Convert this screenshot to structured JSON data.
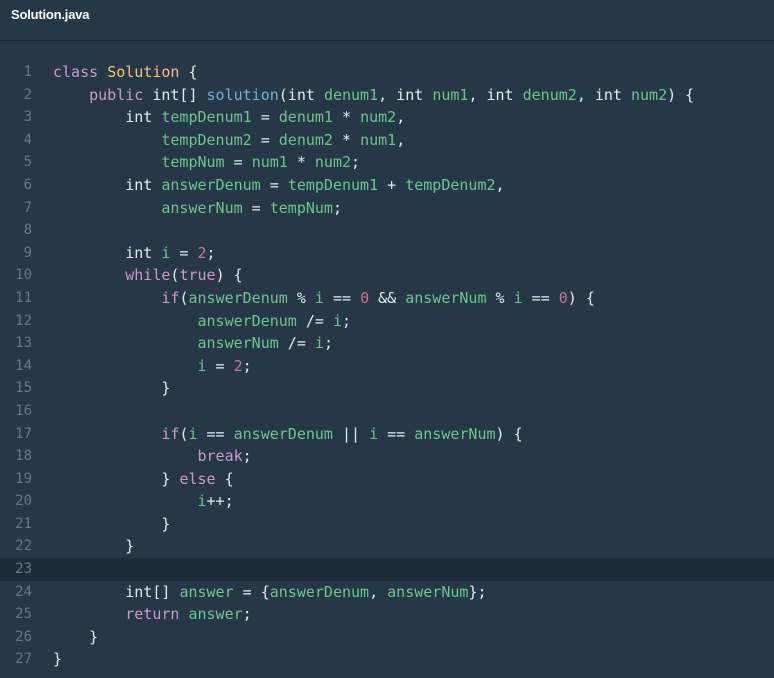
{
  "file": {
    "name": "Solution.java"
  },
  "colors": {
    "background": "#263747",
    "keyword": "#cc99cd",
    "class": "#f0c674",
    "function": "#6fb3d2",
    "variable": "#6cc78a",
    "number": "#d17297",
    "text": "#e6ebf0",
    "gutter": "#6b7787",
    "active_line": "#1e2b3a"
  },
  "editor": {
    "active_line": 23,
    "lines": [
      {
        "n": "1",
        "tokens": [
          [
            "keyword",
            "class"
          ],
          [
            "plain",
            " "
          ],
          [
            "class",
            "Solution"
          ],
          [
            "plain",
            " {"
          ]
        ]
      },
      {
        "n": "2",
        "tokens": [
          [
            "plain",
            "    "
          ],
          [
            "keyword",
            "public"
          ],
          [
            "plain",
            " int[] "
          ],
          [
            "fn",
            "solution"
          ],
          [
            "plain",
            "(int "
          ],
          [
            "var",
            "denum1"
          ],
          [
            "plain",
            ", int "
          ],
          [
            "var",
            "num1"
          ],
          [
            "plain",
            ", int "
          ],
          [
            "var",
            "denum2"
          ],
          [
            "plain",
            ", int "
          ],
          [
            "var",
            "num2"
          ],
          [
            "plain",
            ") {"
          ]
        ]
      },
      {
        "n": "3",
        "tokens": [
          [
            "plain",
            "        int "
          ],
          [
            "var",
            "tempDenum1"
          ],
          [
            "plain",
            " = "
          ],
          [
            "var",
            "denum1"
          ],
          [
            "plain",
            " * "
          ],
          [
            "var",
            "num2"
          ],
          [
            "plain",
            ","
          ]
        ]
      },
      {
        "n": "4",
        "tokens": [
          [
            "plain",
            "            "
          ],
          [
            "var",
            "tempDenum2"
          ],
          [
            "plain",
            " = "
          ],
          [
            "var",
            "denum2"
          ],
          [
            "plain",
            " * "
          ],
          [
            "var",
            "num1"
          ],
          [
            "plain",
            ","
          ]
        ]
      },
      {
        "n": "5",
        "tokens": [
          [
            "plain",
            "            "
          ],
          [
            "var",
            "tempNum"
          ],
          [
            "plain",
            " = "
          ],
          [
            "var",
            "num1"
          ],
          [
            "plain",
            " * "
          ],
          [
            "var",
            "num2"
          ],
          [
            "plain",
            ";"
          ]
        ]
      },
      {
        "n": "6",
        "tokens": [
          [
            "plain",
            "        int "
          ],
          [
            "var",
            "answerDenum"
          ],
          [
            "plain",
            " = "
          ],
          [
            "var",
            "tempDenum1"
          ],
          [
            "plain",
            " + "
          ],
          [
            "var",
            "tempDenum2"
          ],
          [
            "plain",
            ","
          ]
        ]
      },
      {
        "n": "7",
        "tokens": [
          [
            "plain",
            "            "
          ],
          [
            "var",
            "answerNum"
          ],
          [
            "plain",
            " = "
          ],
          [
            "var",
            "tempNum"
          ],
          [
            "plain",
            ";"
          ]
        ]
      },
      {
        "n": "8",
        "tokens": []
      },
      {
        "n": "9",
        "tokens": [
          [
            "plain",
            "        int "
          ],
          [
            "var",
            "i"
          ],
          [
            "plain",
            " = "
          ],
          [
            "num",
            "2"
          ],
          [
            "plain",
            ";"
          ]
        ]
      },
      {
        "n": "10",
        "tokens": [
          [
            "plain",
            "        "
          ],
          [
            "keyword",
            "while"
          ],
          [
            "plain",
            "("
          ],
          [
            "keyword",
            "true"
          ],
          [
            "plain",
            ") {"
          ]
        ]
      },
      {
        "n": "11",
        "tokens": [
          [
            "plain",
            "            "
          ],
          [
            "keyword",
            "if"
          ],
          [
            "plain",
            "("
          ],
          [
            "var",
            "answerDenum"
          ],
          [
            "plain",
            " % "
          ],
          [
            "var",
            "i"
          ],
          [
            "plain",
            " == "
          ],
          [
            "num",
            "0"
          ],
          [
            "plain",
            " && "
          ],
          [
            "var",
            "answerNum"
          ],
          [
            "plain",
            " % "
          ],
          [
            "var",
            "i"
          ],
          [
            "plain",
            " == "
          ],
          [
            "num",
            "0"
          ],
          [
            "plain",
            ") {"
          ]
        ]
      },
      {
        "n": "12",
        "tokens": [
          [
            "plain",
            "                "
          ],
          [
            "var",
            "answerDenum"
          ],
          [
            "plain",
            " /= "
          ],
          [
            "var",
            "i"
          ],
          [
            "plain",
            ";"
          ]
        ]
      },
      {
        "n": "13",
        "tokens": [
          [
            "plain",
            "                "
          ],
          [
            "var",
            "answerNum"
          ],
          [
            "plain",
            " /= "
          ],
          [
            "var",
            "i"
          ],
          [
            "plain",
            ";"
          ]
        ]
      },
      {
        "n": "14",
        "tokens": [
          [
            "plain",
            "                "
          ],
          [
            "var",
            "i"
          ],
          [
            "plain",
            " = "
          ],
          [
            "num",
            "2"
          ],
          [
            "plain",
            ";"
          ]
        ]
      },
      {
        "n": "15",
        "tokens": [
          [
            "plain",
            "            }"
          ]
        ]
      },
      {
        "n": "16",
        "tokens": []
      },
      {
        "n": "17",
        "tokens": [
          [
            "plain",
            "            "
          ],
          [
            "keyword",
            "if"
          ],
          [
            "plain",
            "("
          ],
          [
            "var",
            "i"
          ],
          [
            "plain",
            " == "
          ],
          [
            "var",
            "answerDenum"
          ],
          [
            "plain",
            " || "
          ],
          [
            "var",
            "i"
          ],
          [
            "plain",
            " == "
          ],
          [
            "var",
            "answerNum"
          ],
          [
            "plain",
            ") {"
          ]
        ]
      },
      {
        "n": "18",
        "tokens": [
          [
            "plain",
            "                "
          ],
          [
            "keyword",
            "break"
          ],
          [
            "plain",
            ";"
          ]
        ]
      },
      {
        "n": "19",
        "tokens": [
          [
            "plain",
            "            } "
          ],
          [
            "keyword",
            "else"
          ],
          [
            "plain",
            " {"
          ]
        ]
      },
      {
        "n": "20",
        "tokens": [
          [
            "plain",
            "                "
          ],
          [
            "var",
            "i"
          ],
          [
            "plain",
            "++;"
          ]
        ]
      },
      {
        "n": "21",
        "tokens": [
          [
            "plain",
            "            }"
          ]
        ]
      },
      {
        "n": "22",
        "tokens": [
          [
            "plain",
            "        }"
          ]
        ]
      },
      {
        "n": "23",
        "tokens": []
      },
      {
        "n": "24",
        "tokens": [
          [
            "plain",
            "        int[] "
          ],
          [
            "var",
            "answer"
          ],
          [
            "plain",
            " = {"
          ],
          [
            "var",
            "answerDenum"
          ],
          [
            "plain",
            ", "
          ],
          [
            "var",
            "answerNum"
          ],
          [
            "plain",
            "};"
          ]
        ]
      },
      {
        "n": "25",
        "tokens": [
          [
            "plain",
            "        "
          ],
          [
            "keyword",
            "return"
          ],
          [
            "plain",
            " "
          ],
          [
            "var",
            "answer"
          ],
          [
            "plain",
            ";"
          ]
        ]
      },
      {
        "n": "26",
        "tokens": [
          [
            "plain",
            "    }"
          ]
        ]
      },
      {
        "n": "27",
        "tokens": [
          [
            "plain",
            "}"
          ]
        ]
      }
    ]
  }
}
